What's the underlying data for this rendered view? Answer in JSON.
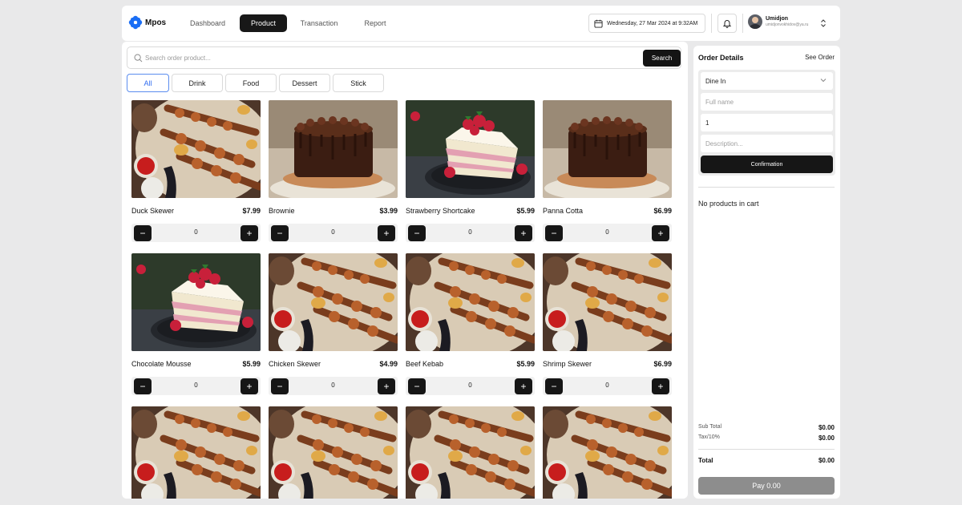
{
  "app": {
    "name": "Mpos"
  },
  "nav": {
    "items": [
      "Dashboard",
      "Product",
      "Transaction",
      "Report"
    ],
    "active": "Product"
  },
  "header": {
    "datetime": "Wednesday, 27 Mar 2024 at 9:32AM"
  },
  "user": {
    "name": "Umidjon",
    "email": "umidjonvokhidov@ya.ru"
  },
  "search": {
    "placeholder": "Search order product...",
    "value": "",
    "button": "Search"
  },
  "categories": [
    "All",
    "Drink",
    "Food",
    "Dessert",
    "Stick"
  ],
  "active_category": "All",
  "products": [
    {
      "name": "Duck Skewer",
      "price": "$7.99",
      "qty": "0",
      "image": "skewer-platter"
    },
    {
      "name": "Brownie",
      "price": "$3.99",
      "qty": "0",
      "image": "chocolate-cake"
    },
    {
      "name": "Strawberry Shortcake",
      "price": "$5.99",
      "qty": "0",
      "image": "strawberry-cake-slice"
    },
    {
      "name": "Panna Cotta",
      "price": "$6.99",
      "qty": "0",
      "image": "chocolate-cake"
    },
    {
      "name": "Chocolate Mousse",
      "price": "$5.99",
      "qty": "0",
      "image": "strawberry-cake-slice"
    },
    {
      "name": "Chicken Skewer",
      "price": "$4.99",
      "qty": "0",
      "image": "skewer-platter"
    },
    {
      "name": "Beef Kebab",
      "price": "$5.99",
      "qty": "0",
      "image": "skewer-platter"
    },
    {
      "name": "Shrimp Skewer",
      "price": "$6.99",
      "qty": "0",
      "image": "skewer-platter"
    },
    {
      "name": "",
      "price": "",
      "qty": "",
      "image": "skewer-platter"
    },
    {
      "name": "",
      "price": "",
      "qty": "",
      "image": "skewer-platter"
    },
    {
      "name": "",
      "price": "",
      "qty": "",
      "image": "skewer-platter"
    },
    {
      "name": "",
      "price": "",
      "qty": "",
      "image": "skewer-platter"
    }
  ],
  "order": {
    "title": "Order Details",
    "see_order": "See Order",
    "dine_option": "Dine In",
    "fullname_placeholder": "Full name",
    "quantity_value": "1",
    "description_placeholder": "Description...",
    "confirm": "Confirmation",
    "empty_cart": "No products in cart",
    "subtotal_label": "Sub Total",
    "subtotal": "$0.00",
    "tax_label": "Tax/10%",
    "tax": "$0.00",
    "total_label": "Total",
    "total": "$0.00",
    "pay": "Pay 0.00"
  },
  "colors": {
    "primary": "#161616",
    "accent": "#2f6cf0",
    "logo": "#1a6ef5",
    "pay_disabled": "#8d8d8d"
  }
}
